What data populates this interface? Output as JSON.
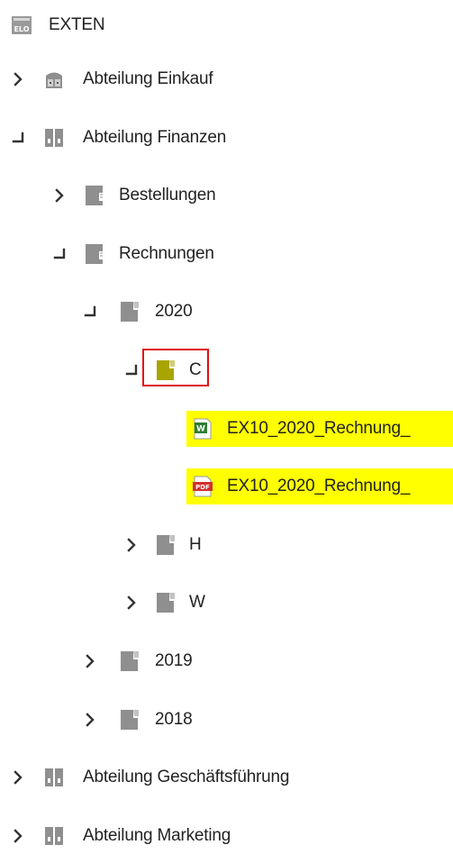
{
  "root": {
    "label": "EXTEN",
    "icon": "elo-archive-icon",
    "icon_text": "ELO"
  },
  "tree": [
    {
      "id": "abteilung-einkauf",
      "label": "Abteilung Einkauf",
      "icon": "cabinet-icon",
      "state": "collapsed",
      "level": 0
    },
    {
      "id": "abteilung-finanzen",
      "label": "Abteilung Finanzen",
      "icon": "binder-icon",
      "state": "expanded",
      "level": 0
    },
    {
      "id": "bestellungen",
      "label": "Bestellungen",
      "icon": "folder-icon",
      "state": "collapsed",
      "level": 1
    },
    {
      "id": "rechnungen",
      "label": "Rechnungen",
      "icon": "folder-icon",
      "state": "expanded",
      "level": 1
    },
    {
      "id": "2020",
      "label": "2020",
      "icon": "register-icon",
      "state": "expanded",
      "level": 2
    },
    {
      "id": "c",
      "label": "C",
      "icon": "register-icon",
      "state": "expanded",
      "level": 3,
      "selected": true
    },
    {
      "id": "ex10-word",
      "label": "EX10_2020_Rechnung_",
      "icon": "word-document-icon",
      "state": "leaf",
      "level": 4,
      "highlighted": true
    },
    {
      "id": "ex10-pdf",
      "label": "EX10_2020_Rechnung_",
      "icon": "pdf-document-icon",
      "state": "leaf",
      "level": 4,
      "highlighted": true
    },
    {
      "id": "h",
      "label": "H",
      "icon": "register-icon",
      "state": "collapsed",
      "level": 3
    },
    {
      "id": "w",
      "label": "W",
      "icon": "register-icon",
      "state": "collapsed",
      "level": 3
    },
    {
      "id": "2019",
      "label": "2019",
      "icon": "register-icon",
      "state": "collapsed",
      "level": 2
    },
    {
      "id": "2018",
      "label": "2018",
      "icon": "register-icon",
      "state": "collapsed",
      "level": 2
    },
    {
      "id": "abteilung-geschaeftsfuehrung",
      "label": "Abteilung Geschäftsführung",
      "icon": "binder-icon",
      "state": "collapsed",
      "level": 0
    },
    {
      "id": "abteilung-marketing",
      "label": "Abteilung Marketing",
      "icon": "binder-icon",
      "state": "collapsed",
      "level": 0
    }
  ],
  "file_badges": {
    "word": "W",
    "pdf": "PDF"
  },
  "colors": {
    "highlight": "#ffff00",
    "selection_border": "#e01010",
    "selected_icon": "#a8a400",
    "icon_gray": "#8f8f8f",
    "word_green": "#2e7d32",
    "pdf_red": "#d32f2f"
  }
}
